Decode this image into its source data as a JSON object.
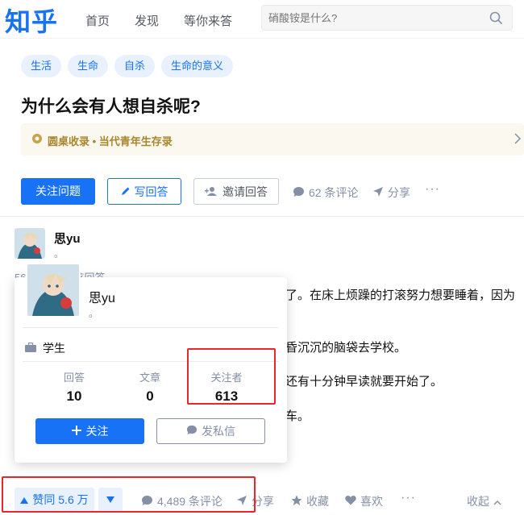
{
  "header": {
    "logo": "知乎",
    "nav": [
      "首页",
      "发现",
      "等你来答"
    ],
    "search_placeholder": "硝酸铵是什么?"
  },
  "question": {
    "topics": [
      "生活",
      "生命",
      "自杀",
      "生命的意义"
    ],
    "title": "为什么会有人想自杀呢?",
    "roundtable": "圆桌收录 • 当代青年生存录",
    "follow_label": "关注问题",
    "write_label": "写回答",
    "invite_label": "邀请回答",
    "comments_label": "62 条评论",
    "share_label": "分享",
    "more_label": "···"
  },
  "answer": {
    "author_name": "思yu",
    "author_dot": "。",
    "upvote_info": "56,… 人赞同了该回答",
    "upvote_info_visible": "56",
    "upvote_info_tail": "了该回答",
    "lines": [
      "了。在床上烦躁的打滚努力想要睡着，因为",
      "昏沉沉的脑袋去学校。",
      "还有十分钟早读就要开始了。",
      "车。"
    ]
  },
  "profile_card": {
    "name": "思yu",
    "dot": "。",
    "occupation": "学生",
    "stats": [
      {
        "label": "回答",
        "value": "10"
      },
      {
        "label": "文章",
        "value": "0"
      },
      {
        "label": "关注者",
        "value": "613"
      }
    ],
    "follow_label": "关注",
    "message_label": "发私信"
  },
  "actions": {
    "upvote_label": "赞同 5.6 万",
    "comments_label": "4,489 条评论",
    "share_label": "分享",
    "collect_label": "收藏",
    "like_label": "喜欢",
    "more_label": "···",
    "collapse_label": "收起"
  },
  "colors": {
    "brand": "#1772f6",
    "highlight": "#e8262c",
    "roundtable": "#a8862d"
  }
}
